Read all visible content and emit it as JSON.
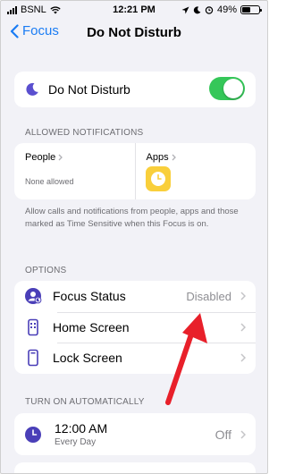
{
  "status": {
    "carrier": "BSNL",
    "time": "12:21 PM",
    "battery": "49%",
    "battery_level": 0.49
  },
  "nav": {
    "back_label": "Focus",
    "title": "Do Not Disturb"
  },
  "dnd": {
    "label": "Do Not Disturb",
    "enabled": true,
    "icon": "moon-icon"
  },
  "allowed": {
    "header": "ALLOWED NOTIFICATIONS",
    "people_title": "People",
    "people_sub": "None allowed",
    "apps_title": "Apps",
    "apps_icon": "clock-app-icon",
    "description": "Allow calls and notifications from people, apps and those marked as Time Sensitive when this Focus is on."
  },
  "options": {
    "header": "OPTIONS",
    "items": [
      {
        "label": "Focus Status",
        "value": "Disabled",
        "icon": "focus-status-icon"
      },
      {
        "label": "Home Screen",
        "value": "",
        "icon": "home-screen-icon"
      },
      {
        "label": "Lock Screen",
        "value": "",
        "icon": "lock-screen-icon"
      }
    ]
  },
  "automation": {
    "header": "TURN ON AUTOMATICALLY",
    "schedule_time": "12:00 AM",
    "schedule_repeat": "Every Day",
    "schedule_value": "Off"
  },
  "colors": {
    "accent": "#1a7cf4",
    "toggle_on": "#35c759",
    "annotation_arrow": "#e8202a",
    "moon": "#5a4fcf"
  }
}
